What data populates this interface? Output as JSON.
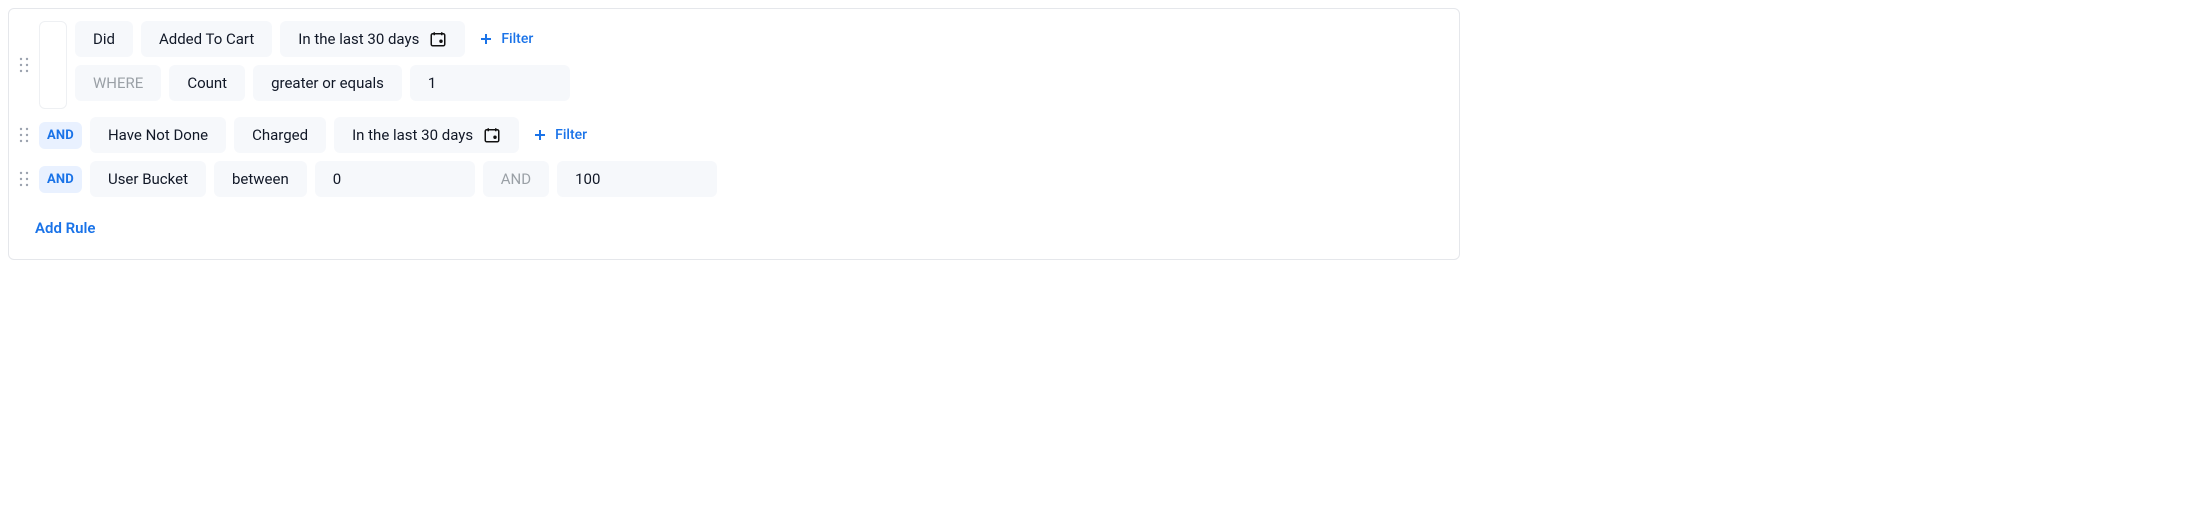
{
  "operators": {
    "and": "AND"
  },
  "rules": [
    {
      "verb": "Did",
      "event": "Added To Cart",
      "timeframe": "In the last 30 days",
      "filter_label": "Filter",
      "where": {
        "label": "WHERE",
        "metric": "Count",
        "comparator": "greater or equals",
        "value": "1"
      }
    },
    {
      "verb": "Have Not Done",
      "event": "Charged",
      "timeframe": "In the last 30 days",
      "filter_label": "Filter"
    },
    {
      "property": "User Bucket",
      "comparator": "between",
      "from": "0",
      "between_conj": "AND",
      "to": "100"
    }
  ],
  "add_rule_label": "Add Rule"
}
